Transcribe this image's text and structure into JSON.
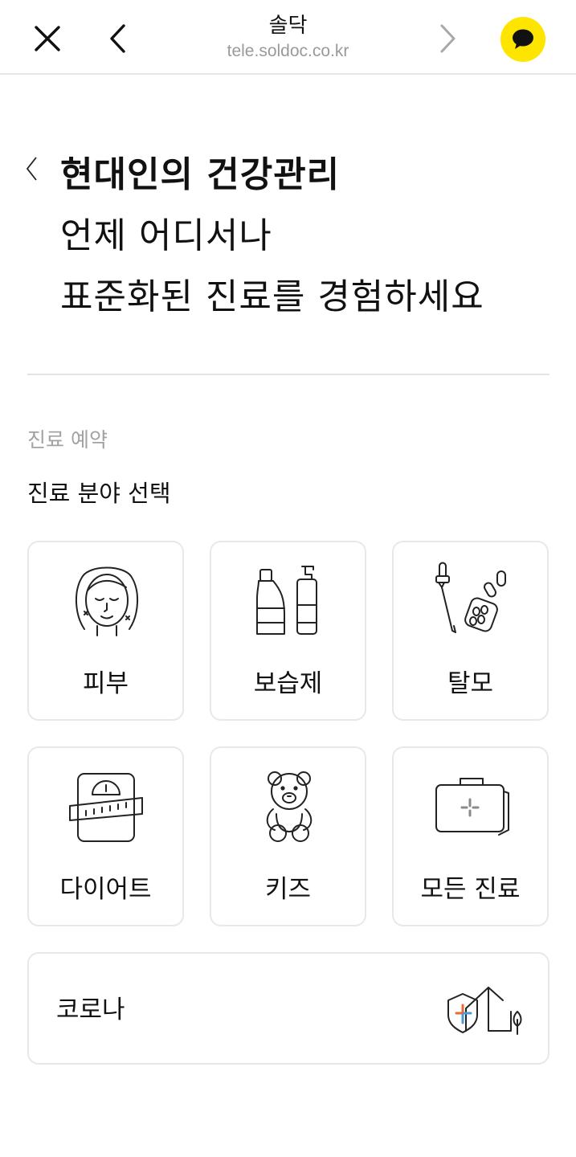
{
  "header": {
    "title": "솔닥",
    "url": "tele.soldoc.co.kr",
    "icons": {
      "close": "close-icon",
      "back": "chevron-left-icon",
      "forward": "chevron-right-icon",
      "chat": "kakao-chat-icon"
    },
    "chat_color": "#fee500"
  },
  "hero": {
    "line1": "현대인의 건강관리",
    "line2": "언제 어디서나",
    "line3": "표준화된 진료를 경험하세요"
  },
  "booking": {
    "label": "진료 예약",
    "title": "진료 분야 선택",
    "categories": [
      {
        "label": "피부",
        "icon": "face-skin-icon"
      },
      {
        "label": "보습제",
        "icon": "moisturizer-bottles-icon"
      },
      {
        "label": "탈모",
        "icon": "dropper-pills-icon"
      },
      {
        "label": "다이어트",
        "icon": "scale-tape-icon"
      },
      {
        "label": "키즈",
        "icon": "teddy-bear-icon"
      },
      {
        "label": "모든 진료",
        "icon": "medical-kit-icon"
      }
    ],
    "covid": {
      "label": "코로나",
      "icon": "shield-house-icon"
    }
  }
}
